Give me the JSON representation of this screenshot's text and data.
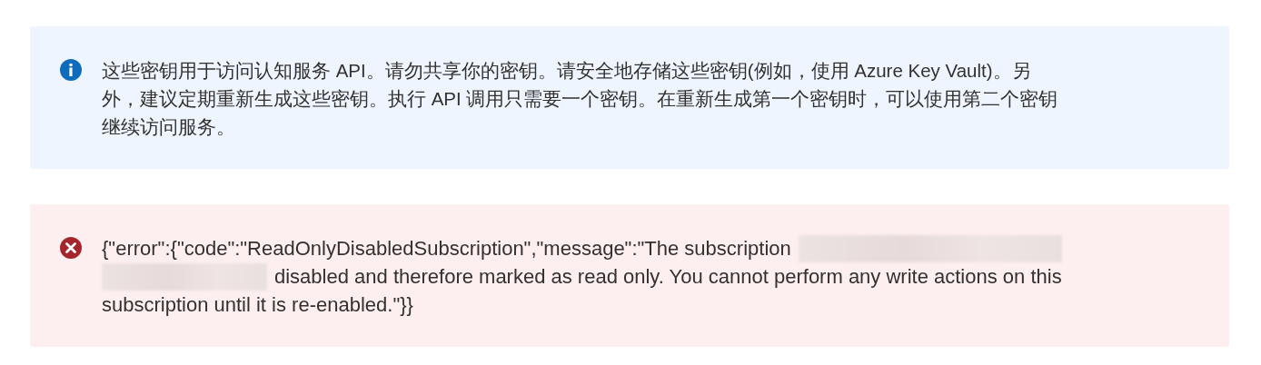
{
  "banners": [
    {
      "kind": "info",
      "lines": [
        [
          {
            "kind": "text",
            "text": "这些密钥用于访问认知服务 API。请勿共享你的密钥。请安全地存储这些密钥(例如，使用 Azure Key Vault)。另"
          }
        ],
        [
          {
            "kind": "text",
            "text": "外，建议定期重新生成这些密钥。执行 API 调用只需要一个密钥。在重新生成第一个密钥时，可以使用第二个密钥"
          }
        ],
        [
          {
            "kind": "text",
            "text": "继续访问服务。"
          }
        ]
      ]
    },
    {
      "kind": "error",
      "lines": [
        [
          {
            "kind": "text",
            "text": "{\"error\":{\"code\":\"ReadOnlyDisabledSubscription\",\"message\":\"The subscription"
          },
          {
            "kind": "redacted"
          }
        ],
        [
          {
            "kind": "redacted"
          },
          {
            "kind": "text",
            "text": "disabled and therefore marked as read only. You cannot perform any write actions on this"
          }
        ],
        [
          {
            "kind": "text",
            "text": "subscription until it is re-enabled.\"}}"
          }
        ]
      ]
    }
  ]
}
